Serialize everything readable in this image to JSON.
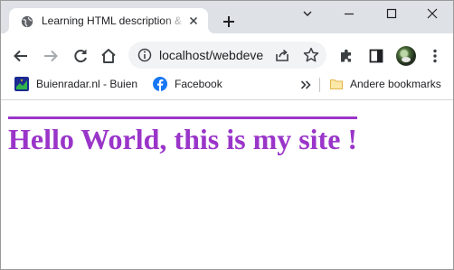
{
  "browser": {
    "tab": {
      "title": "Learning HTML description & ..."
    },
    "address_bar": {
      "url": "localhost/webdevelopment"
    },
    "bookmarks": [
      {
        "label": "Buienradar.nl - Buienradar",
        "icon": "buienradar-icon"
      },
      {
        "label": "Facebook",
        "icon": "facebook-icon"
      }
    ],
    "other_bookmarks": {
      "label": "Andere bookmarks",
      "icon": "folder-icon"
    }
  },
  "page": {
    "heading": "Hello World, this is my site !"
  },
  "colors": {
    "heading": "#9a35c9",
    "tab_strip": "#dee1e6",
    "omnibox": "#f1f3f4",
    "facebook": "#1877f2"
  }
}
